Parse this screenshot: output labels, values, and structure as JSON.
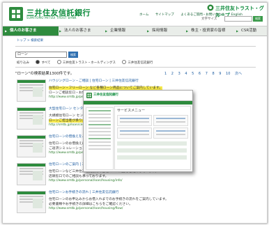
{
  "header": {
    "logo_jp": "三井住友信託銀行",
    "logo_en": "SUMITOMO MITSUI TRUST BANK",
    "group_name": "三井住友トラスト・グループ",
    "util_links": [
      "ホーム",
      "サイトマップ",
      "よくあるご質問・お問い合わせ",
      "English"
    ],
    "text_size_label": "文字サイズ",
    "text_size_options": [
      "小",
      "中",
      "大"
    ],
    "search_button": "検索"
  },
  "nav": {
    "items": [
      "個人のお客さま",
      "法人のお客さま",
      "企業情報",
      "採用情報",
      "株主・投資家の皆様",
      "CSR活動"
    ],
    "active_index": 0
  },
  "breadcrumb": "トップ > 検索結果",
  "search": {
    "query": "ローン",
    "button": "検索",
    "scope_label": "絞り込み",
    "scopes": [
      "すべて",
      "三井住友トラスト・ホールディングス",
      "三井住友信託銀行"
    ],
    "selected_scope": 0
  },
  "results_summary": "\"ローン\"の検索結果1300件です。",
  "pager": [
    "1",
    "2",
    "3",
    "4",
    "5",
    "6",
    "7",
    "8",
    "9",
    "10",
    "次へ"
  ],
  "results": [
    {
      "title": "ハウジングローン・ご相談 | 住宅ローン | 三井住友信託銀行",
      "line1": "住宅ローン・フリーローン など各種ローン商品についてご案内しています。",
      "line2": "ローンご相談窓口・お借入れのお手続きはこちらからご利用ください。",
      "url": "http://www.smtb.jp/personal/loan/housing/"
    },
    {
      "title": "大型住宅ローン センター | 住宅ローン | 三井住友信託銀行",
      "line1": "大規模住宅ローン センターのご案内。住宅購入・借換えのご相談を",
      "line2": "ローンご担当者が承ります。お気軽にお問い合わせください。",
      "url": "http://smtb.jp/loan/center/"
    },
    {
      "title": "住宅ローンの借換えをご検討の方 | 三井住友信託銀行",
      "line1": "住宅ローンのお借換えについて、金利タイプや諸費用などをご案内しています。",
      "line2": "ご返済シミュレーションもご利用いただけます。",
      "url": "http://www.smtb.jp/personal/loan/housing/refinance/"
    },
    {
      "title": "住宅ローンのご案内 | 三井住友信託銀行",
      "line1": "住宅ローンなど三井住友信託銀行の各種ローン商品をご紹介しています。",
      "line2": "店頭窓口でのご相談も承っております。",
      "url": "http://www.smtb.jp/personal/loan/housing/info/"
    },
    {
      "title": "住宅ローンお手続きの流れ | 三井住友信託銀行",
      "line1": "住宅ローンのお申込みからお借入れまでのお手続きの流れをご案内しています。",
      "line2": "必要書類やお手続きの詳細はこちらをご確認ください。",
      "url": "http://www.smtb.jp/personal/loan/housing/flow/"
    }
  ],
  "popup": {
    "logo": "三井住友信託銀行",
    "section_title": "サービスメニュー"
  },
  "colors": {
    "brand_green": "#2e8b3e",
    "link_blue": "#1a5aa0",
    "highlight": "#f5e84a"
  }
}
